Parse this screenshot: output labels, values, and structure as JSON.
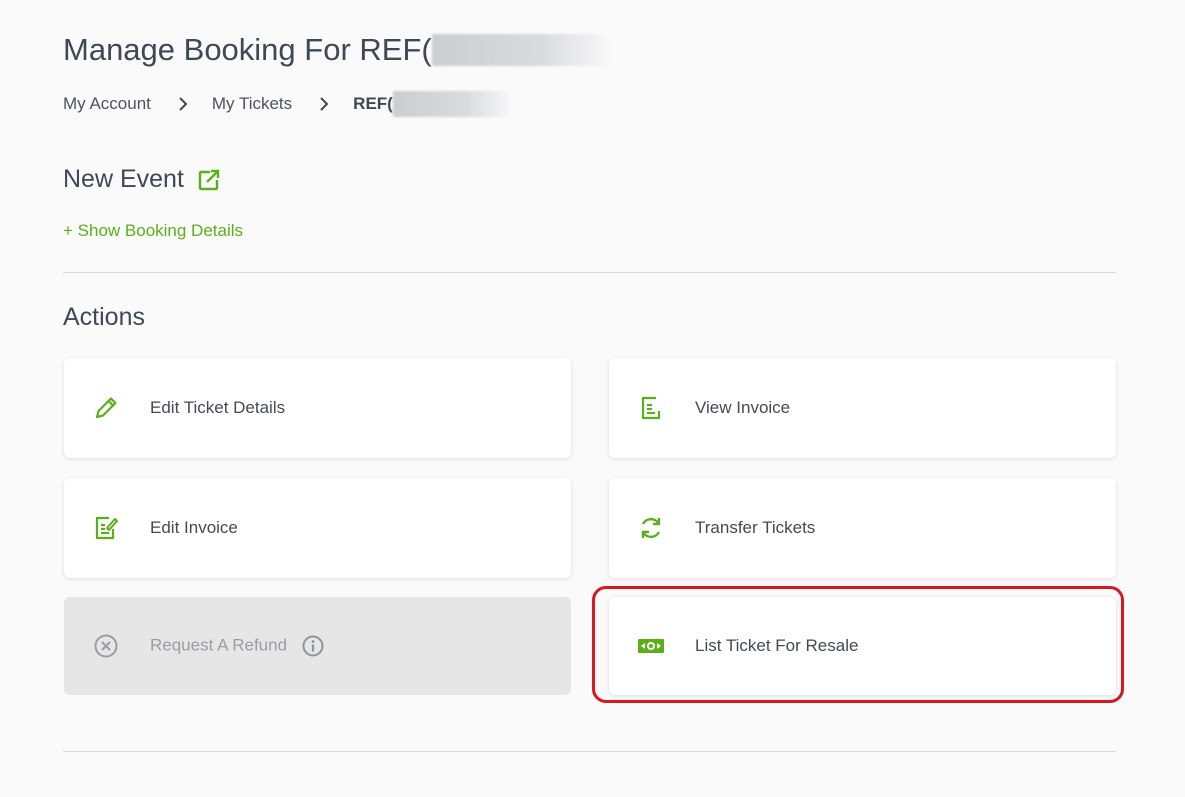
{
  "header": {
    "title": "Manage Booking For REF("
  },
  "breadcrumb": {
    "items": [
      "My Account",
      "My Tickets"
    ],
    "current": "REF("
  },
  "event": {
    "title": "New Event",
    "show_details_label": "+ Show Booking Details"
  },
  "actions": {
    "title": "Actions",
    "items": [
      {
        "label": "Edit Ticket Details",
        "icon": "pencil-icon"
      },
      {
        "label": "View Invoice",
        "icon": "invoice-icon"
      },
      {
        "label": "Edit Invoice",
        "icon": "edit-invoice-icon"
      },
      {
        "label": "Transfer Tickets",
        "icon": "refresh-icon"
      },
      {
        "label": "Request A Refund",
        "icon": "close-circle-icon",
        "disabled": true
      },
      {
        "label": "List Ticket For Resale",
        "icon": "money-icon"
      }
    ]
  },
  "colors": {
    "accent": "#5bb01a",
    "text": "#414a56",
    "highlight": "#d7181f"
  }
}
